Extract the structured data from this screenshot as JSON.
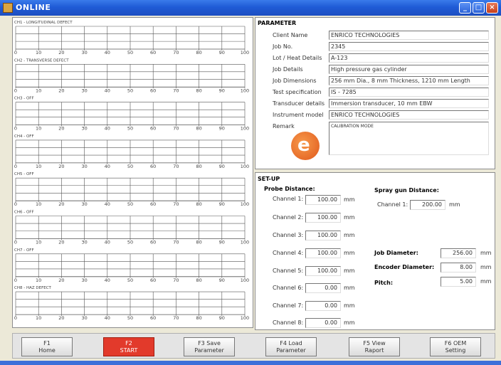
{
  "window": {
    "title": "ONLINE"
  },
  "charts": {
    "ticks": [
      "0",
      "10",
      "20",
      "30",
      "40",
      "50",
      "60",
      "70",
      "80",
      "90",
      "100"
    ],
    "channels": [
      {
        "label": "CH1 - LONGITUDINAL DEFECT"
      },
      {
        "label": "CH2 - TRANSVERSE DEFECT"
      },
      {
        "label": "CH3 - OFF"
      },
      {
        "label": "CH4 - OFF"
      },
      {
        "label": "CH5 - OFF"
      },
      {
        "label": "CH6 - OFF"
      },
      {
        "label": "CH7 - OFF"
      },
      {
        "label": "CH8 - HAZ DEFECT"
      }
    ]
  },
  "parameter": {
    "title": "PARAMETER",
    "rows": [
      {
        "label": "Client Name",
        "value": "ENRICO TECHNOLOGIES"
      },
      {
        "label": "Job No.",
        "value": "2345"
      },
      {
        "label": "Lot / Heat Details",
        "value": "A-123"
      },
      {
        "label": "Job Details",
        "value": "High pressure gas cylinder"
      },
      {
        "label": "Job Dimensions",
        "value": "256 mm Dia., 8 mm Thickness, 1210 mm Length"
      },
      {
        "label": "Test specification",
        "value": "IS - 7285"
      },
      {
        "label": "Transducer details",
        "value": "Immersion transducer, 10 mm EBW"
      },
      {
        "label": "Instrument model",
        "value": "ENRICO TECHNOLOGIES"
      }
    ],
    "remark_label": "Remark",
    "remark_value": "CALIBRATION MODE",
    "logo_letter": "e"
  },
  "setup": {
    "title": "SET-UP",
    "probe_title": "Probe Distance:",
    "spray_title": "Spray gun Distance:",
    "unit": "mm",
    "probe_channels": [
      {
        "label": "Channel 1:",
        "value": "100.00"
      },
      {
        "label": "Channel 2:",
        "value": "100.00"
      },
      {
        "label": "Channel 3:",
        "value": "100.00"
      },
      {
        "label": "Channel 4:",
        "value": "100.00"
      },
      {
        "label": "Channel 5:",
        "value": "100.00"
      },
      {
        "label": "Channel 6:",
        "value": "0.00"
      },
      {
        "label": "Channel 7:",
        "value": "0.00"
      },
      {
        "label": "Channel 8:",
        "value": "0.00"
      }
    ],
    "spray_channel": {
      "label": "Channel 1:",
      "value": "200.00"
    },
    "job_diameter": {
      "label": "Job Diameter:",
      "value": "256.00"
    },
    "encoder_diameter": {
      "label": "Encoder Diameter:",
      "value": "8.00"
    },
    "pitch": {
      "label": "Pitch:",
      "value": "5.00"
    }
  },
  "buttons": [
    {
      "key": "F1",
      "label": "Home"
    },
    {
      "key": "F2",
      "label": "START"
    },
    {
      "key": "F3 Save",
      "label": "Parameter"
    },
    {
      "key": "F4 Load",
      "label": "Parameter"
    },
    {
      "key": "F5 View",
      "label": "Raport"
    },
    {
      "key": "F6 OEM",
      "label": "Setting"
    }
  ],
  "colors": {
    "titlebar": "#1f5bd6",
    "start_button": "#e23a2b",
    "logo": "#e8692a"
  }
}
